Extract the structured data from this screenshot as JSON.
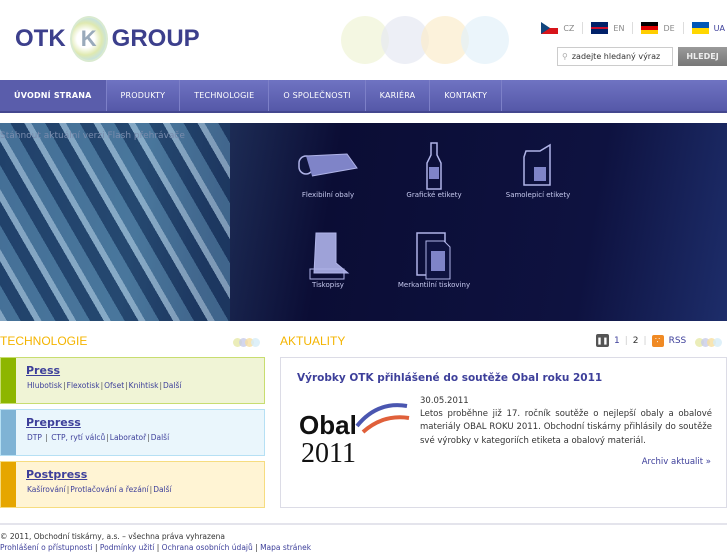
{
  "header": {
    "logo_left": "OTK",
    "logo_mark": "K",
    "logo_right": "GROUP",
    "languages": [
      {
        "code": "CZ",
        "colors": [
          "#fff",
          "#d7141a",
          "#11457e"
        ]
      },
      {
        "code": "EN",
        "colors": [
          "#012169",
          "#c8102e",
          "#fff"
        ]
      },
      {
        "code": "DE",
        "colors": [
          "#000",
          "#dd0000",
          "#ffce00"
        ]
      },
      {
        "code": "UA",
        "colors": [
          "#0057b7",
          "#ffd700"
        ]
      }
    ],
    "search_placeholder": "zadejte hledaný výraz",
    "search_button": "HLEDEJ"
  },
  "nav": [
    "ÚVODNÍ STRANA",
    "PRODUKTY",
    "TECHNOLOGIE",
    "O SPOLEČNOSTI",
    "KARIÉRA",
    "KONTAKTY"
  ],
  "hero": {
    "download": "Stáhnout aktuální verzi Flash přehrávače",
    "products": [
      "Flexibilní obaly",
      "Grafické etikety",
      "Samolepicí etikety",
      "Tiskopisy",
      "Merkantilní tiskoviny"
    ]
  },
  "technologie": {
    "title": "TECHNOLOGIE",
    "items": [
      {
        "title": "Press",
        "links": [
          "Hlubotisk",
          "Flexotisk",
          "Ofset",
          "Knihtisk",
          "Další"
        ],
        "color": "#8db600"
      },
      {
        "title": "Prepress",
        "links": [
          "DTP",
          "CTP, rytí válců",
          "Laboratoř",
          "Další"
        ],
        "color": "#7fb3d5"
      },
      {
        "title": "Postpress",
        "links": [
          "Kašírování",
          "Protlačování a řezání",
          "Další"
        ],
        "color": "#e6a600"
      }
    ]
  },
  "aktuality": {
    "title": "AKTUALITY",
    "pages": [
      "1",
      "2"
    ],
    "rss": "RSS",
    "news_title": "Výrobky OTK přihlášené do soutěže Obal roku 2011",
    "date": "30.05.2011",
    "text": "Letos proběhne již 17. ročník soutěže o nejlepší obaly a obalové materiály OBAL ROKU 2011. Obchodní tiskárny přihlásily do soutěže své výrobky v kategoriích etiketa a obalový materiál.",
    "archive": "Archiv aktualit »",
    "image_text": "Obal roku 2011"
  },
  "footer": {
    "copyright": "© 2011, Obchodní tiskárny, a.s. – všechna práva vyhrazena",
    "links": [
      "Prohlášení o přístupnosti",
      "Podmínky užití",
      "Ochrana osobních údajů",
      "Mapa stránek"
    ]
  }
}
